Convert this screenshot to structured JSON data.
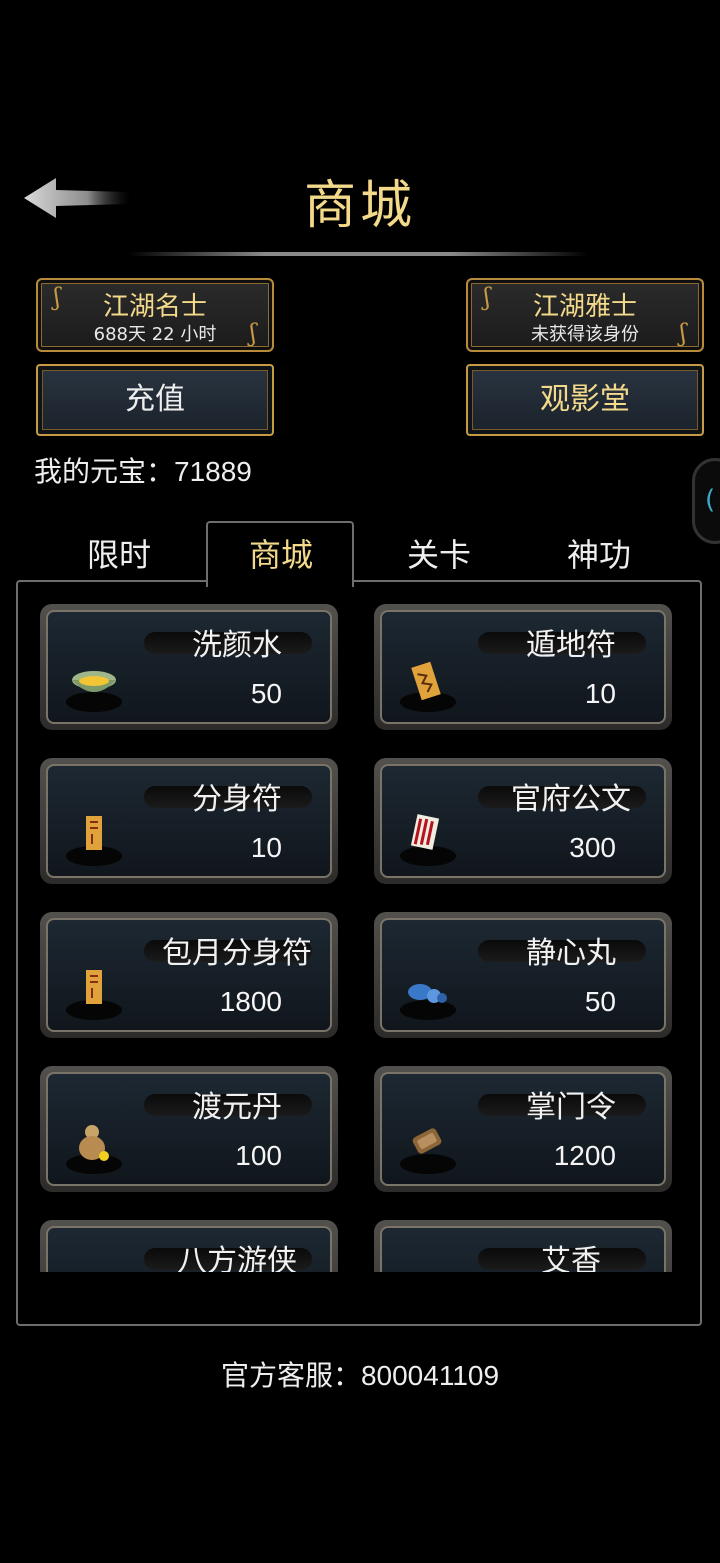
{
  "header": {
    "title": "商城"
  },
  "badges": [
    {
      "title": "江湖名士",
      "subtitle": "688天 22 小时"
    },
    {
      "title": "江湖雅士",
      "subtitle": "未获得该身份"
    }
  ],
  "buttons": {
    "recharge": "充值",
    "cinema": "观影堂"
  },
  "ingot": {
    "label": "我的元宝：",
    "value": "71889"
  },
  "tabs": [
    {
      "label": "限时"
    },
    {
      "label": "商城"
    },
    {
      "label": "关卡"
    },
    {
      "label": "神功"
    }
  ],
  "active_tab": "商城",
  "items": [
    {
      "name": "洗颜水",
      "price": "50",
      "icon": "face-wash-bowl-icon"
    },
    {
      "name": "遁地符",
      "price": "10",
      "icon": "talisman-icon"
    },
    {
      "name": "分身符",
      "price": "10",
      "icon": "talisman-icon"
    },
    {
      "name": "官府公文",
      "price": "300",
      "icon": "official-scroll-icon"
    },
    {
      "name": "包月分身符",
      "price": "1800",
      "icon": "talisman-icon"
    },
    {
      "name": "静心丸",
      "price": "50",
      "icon": "pill-icon"
    },
    {
      "name": "渡元丹",
      "price": "100",
      "icon": "gourd-icon"
    },
    {
      "name": "掌门令",
      "price": "1200",
      "icon": "token-icon"
    },
    {
      "name": "八方游侠",
      "price": "",
      "icon": "hero-icon"
    },
    {
      "name": "艾香",
      "price": "",
      "icon": "incense-icon"
    }
  ],
  "footer": {
    "label": "官方客服：",
    "value": "800041109"
  }
}
